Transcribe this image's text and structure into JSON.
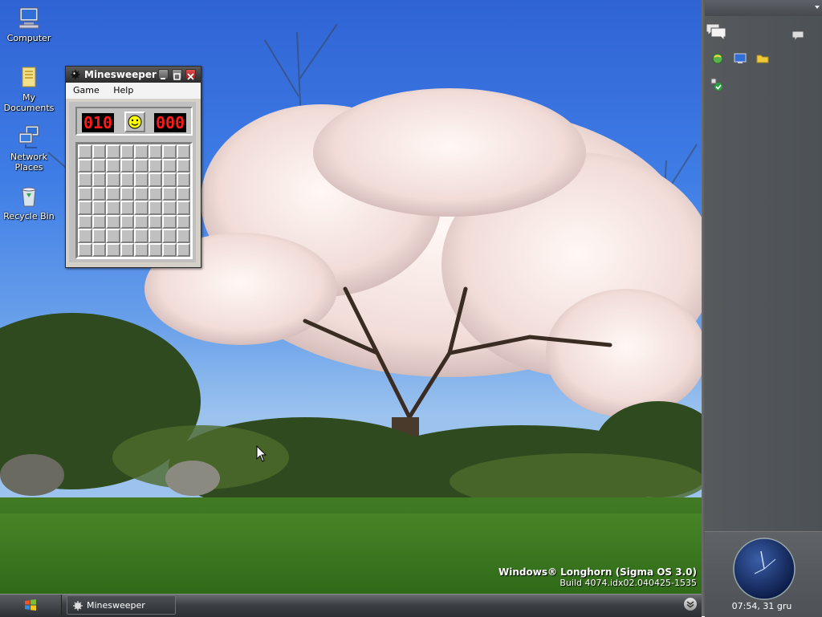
{
  "desktop": {
    "icons": [
      {
        "label": "Computer",
        "icon": "computer-icon"
      },
      {
        "label": "My Documents",
        "icon": "documents-folder-icon"
      },
      {
        "label": "Network Places",
        "icon": "network-places-icon"
      },
      {
        "label": "Recycle Bin",
        "icon": "recycle-bin-icon"
      }
    ],
    "watermark": {
      "line1": "Windows® Longhorn (Sigma OS 3.0)",
      "line2": "Build 4074.idx02.040425-1535"
    }
  },
  "minesweeper": {
    "title": "Minesweeper",
    "menu": [
      "Game",
      "Help"
    ],
    "mine_counter": "010",
    "timer": "000",
    "face": "smiley-face-icon",
    "grid": {
      "rows": 8,
      "cols": 8
    }
  },
  "taskbar": {
    "start_icon": "windows-logo-icon",
    "tasks": [
      {
        "label": "Minesweeper",
        "icon": "minesweeper-icon"
      }
    ]
  },
  "sidebar": {
    "clock": "07:54, 31 gru"
  },
  "colors": {
    "lcd_text": "#ff1a1a",
    "panel_gray": "#c0c0c0",
    "sidebar_bg": "#4c5156"
  }
}
